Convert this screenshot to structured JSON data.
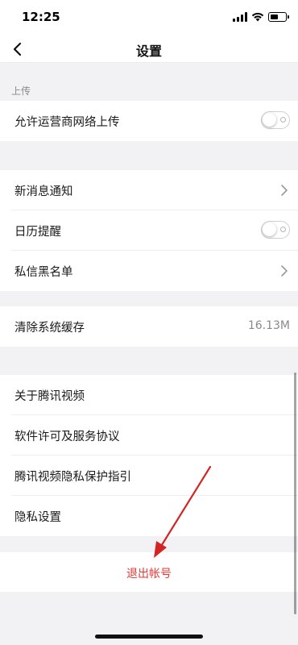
{
  "status_bar": {
    "time": "12:25"
  },
  "nav": {
    "title": "设置"
  },
  "section_upload": {
    "header": "上传",
    "items": [
      {
        "label": "允许运营商网络上传",
        "toggle": false
      }
    ]
  },
  "group_notify": {
    "items": [
      {
        "label": "新消息通知"
      },
      {
        "label": "日历提醒",
        "toggle": false
      },
      {
        "label": "私信黑名单"
      }
    ]
  },
  "group_cache": {
    "items": [
      {
        "label": "清除系统缓存",
        "value": "16.13M"
      }
    ]
  },
  "group_about": {
    "items": [
      {
        "label": "关于腾讯视频"
      },
      {
        "label": "软件许可及服务协议"
      },
      {
        "label": "腾讯视频隐私保护指引"
      },
      {
        "label": "隐私设置"
      }
    ]
  },
  "logout": {
    "label": "退出帐号"
  },
  "colors": {
    "accent_red": "#e43a36",
    "arrow": "#d32424"
  }
}
